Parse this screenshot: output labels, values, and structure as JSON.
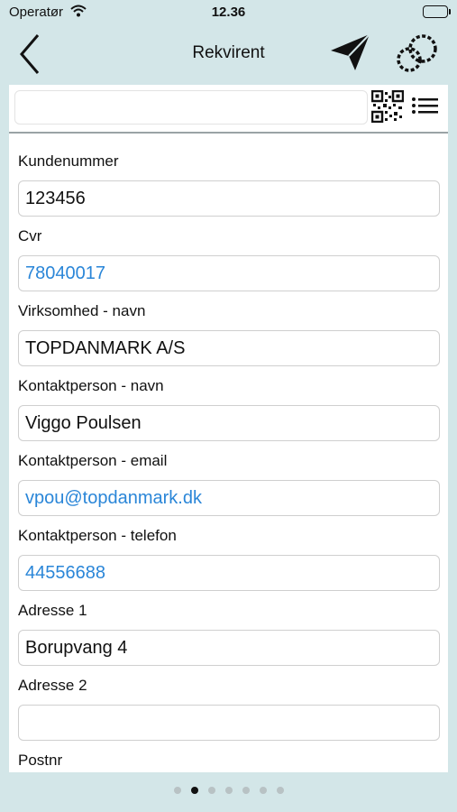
{
  "status_bar": {
    "carrier": "Operatør",
    "time": "12.36"
  },
  "nav": {
    "title": "Rekvirent"
  },
  "search": {
    "value": "",
    "placeholder": ""
  },
  "fields": [
    {
      "label": "Kundenummer",
      "value": "123456",
      "is_link": false
    },
    {
      "label": "Cvr",
      "value": "78040017",
      "is_link": true
    },
    {
      "label": "Virksomhed - navn",
      "value": "TOPDANMARK A/S",
      "is_link": false
    },
    {
      "label": "Kontaktperson - navn",
      "value": "Viggo Poulsen",
      "is_link": false
    },
    {
      "label": "Kontaktperson - email",
      "value": "vpou@topdanmark.dk",
      "is_link": true
    },
    {
      "label": "Kontaktperson - telefon",
      "value": "44556688",
      "is_link": true
    },
    {
      "label": "Adresse 1",
      "value": "Borupvang 4",
      "is_link": false
    },
    {
      "label": "Adresse 2",
      "value": "",
      "is_link": false
    },
    {
      "label": "Postnr",
      "value": "",
      "is_link": false
    }
  ],
  "pager": {
    "count": 7,
    "active_index": 1
  },
  "colors": {
    "background": "#d3e6e8",
    "link": "#2a86d8",
    "card": "#ffffff"
  },
  "icons": {
    "back": "chevron-left-icon",
    "send": "paper-plane-icon",
    "settings": "gear-icon",
    "qr": "qr-code-icon",
    "list": "list-icon"
  }
}
